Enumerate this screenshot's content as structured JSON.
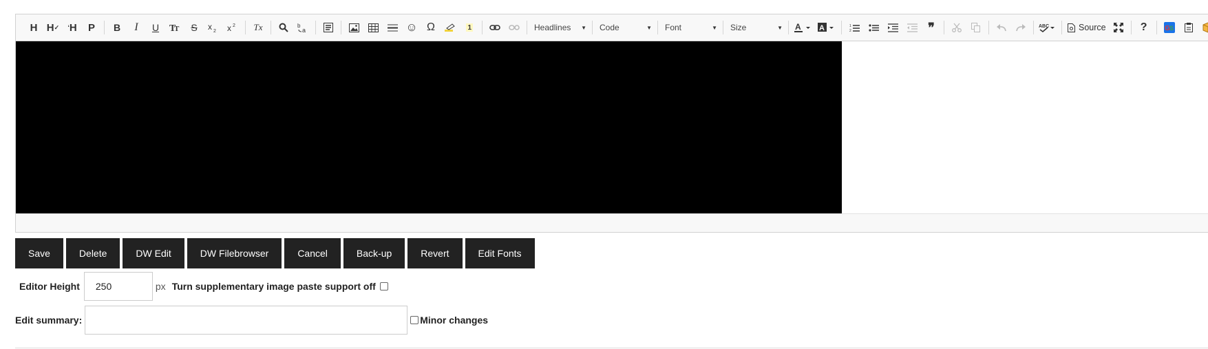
{
  "toolbar": {
    "headings": [
      "H",
      "H",
      "H",
      "P"
    ],
    "format": {
      "bold": "B",
      "italic": "I",
      "underline": "U",
      "strike": "S",
      "remove_format": "Tx"
    },
    "combos": {
      "headlines": "Headlines",
      "code": "Code",
      "font": "Font",
      "size": "Size"
    },
    "source_label": "Source",
    "help_glyph": "?",
    "quote_glyph": "❞",
    "omega_glyph": "Ω",
    "smiley_glyph": "☺"
  },
  "colors": {
    "accent_dark": "#222222",
    "content_block": "#000000"
  },
  "actions": {
    "save": "Save",
    "delete": "Delete",
    "dw_edit": "DW Edit",
    "dw_filebrowser": "DW Filebrowser",
    "cancel": "Cancel",
    "backup": "Back-up",
    "revert": "Revert",
    "edit_fonts": "Edit Fonts"
  },
  "form": {
    "editor_height_label": "Editor Height",
    "editor_height_value": "250",
    "editor_height_unit": "px",
    "paste_support_label": "Turn supplementary image paste support off",
    "edit_summary_label": "Edit summary:",
    "edit_summary_value": "",
    "minor_changes_label": "Minor changes"
  }
}
